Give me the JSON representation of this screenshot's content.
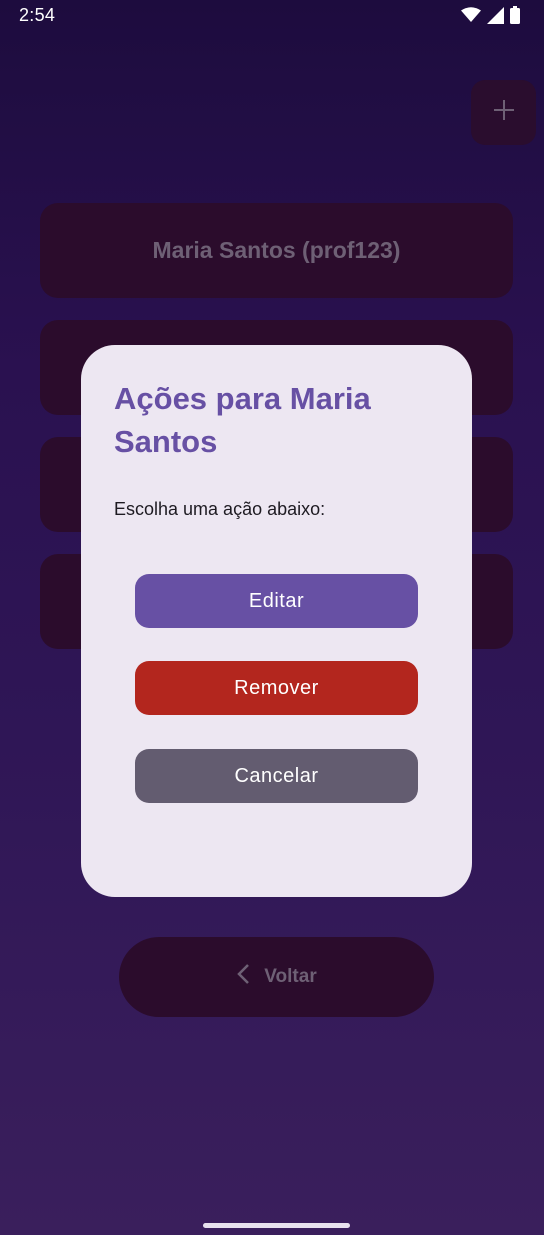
{
  "status_bar": {
    "time": "2:54"
  },
  "toolbar": {
    "add_icon": "plus-icon"
  },
  "list": {
    "items": [
      {
        "label": "Maria Santos (prof123)"
      },
      {
        "label": ""
      },
      {
        "label": ""
      },
      {
        "label": ""
      }
    ]
  },
  "back": {
    "label": "Voltar",
    "icon": "chevron-left-icon"
  },
  "dialog": {
    "title": "Ações para Maria Santos",
    "message": "Escolha uma ação abaixo:",
    "edit_label": "Editar",
    "remove_label": "Remover",
    "cancel_label": "Cancelar"
  },
  "colors": {
    "primary": "#6750a4",
    "danger": "#b3261e",
    "neutral": "#635c70",
    "dialog_bg": "#ede7f2"
  }
}
